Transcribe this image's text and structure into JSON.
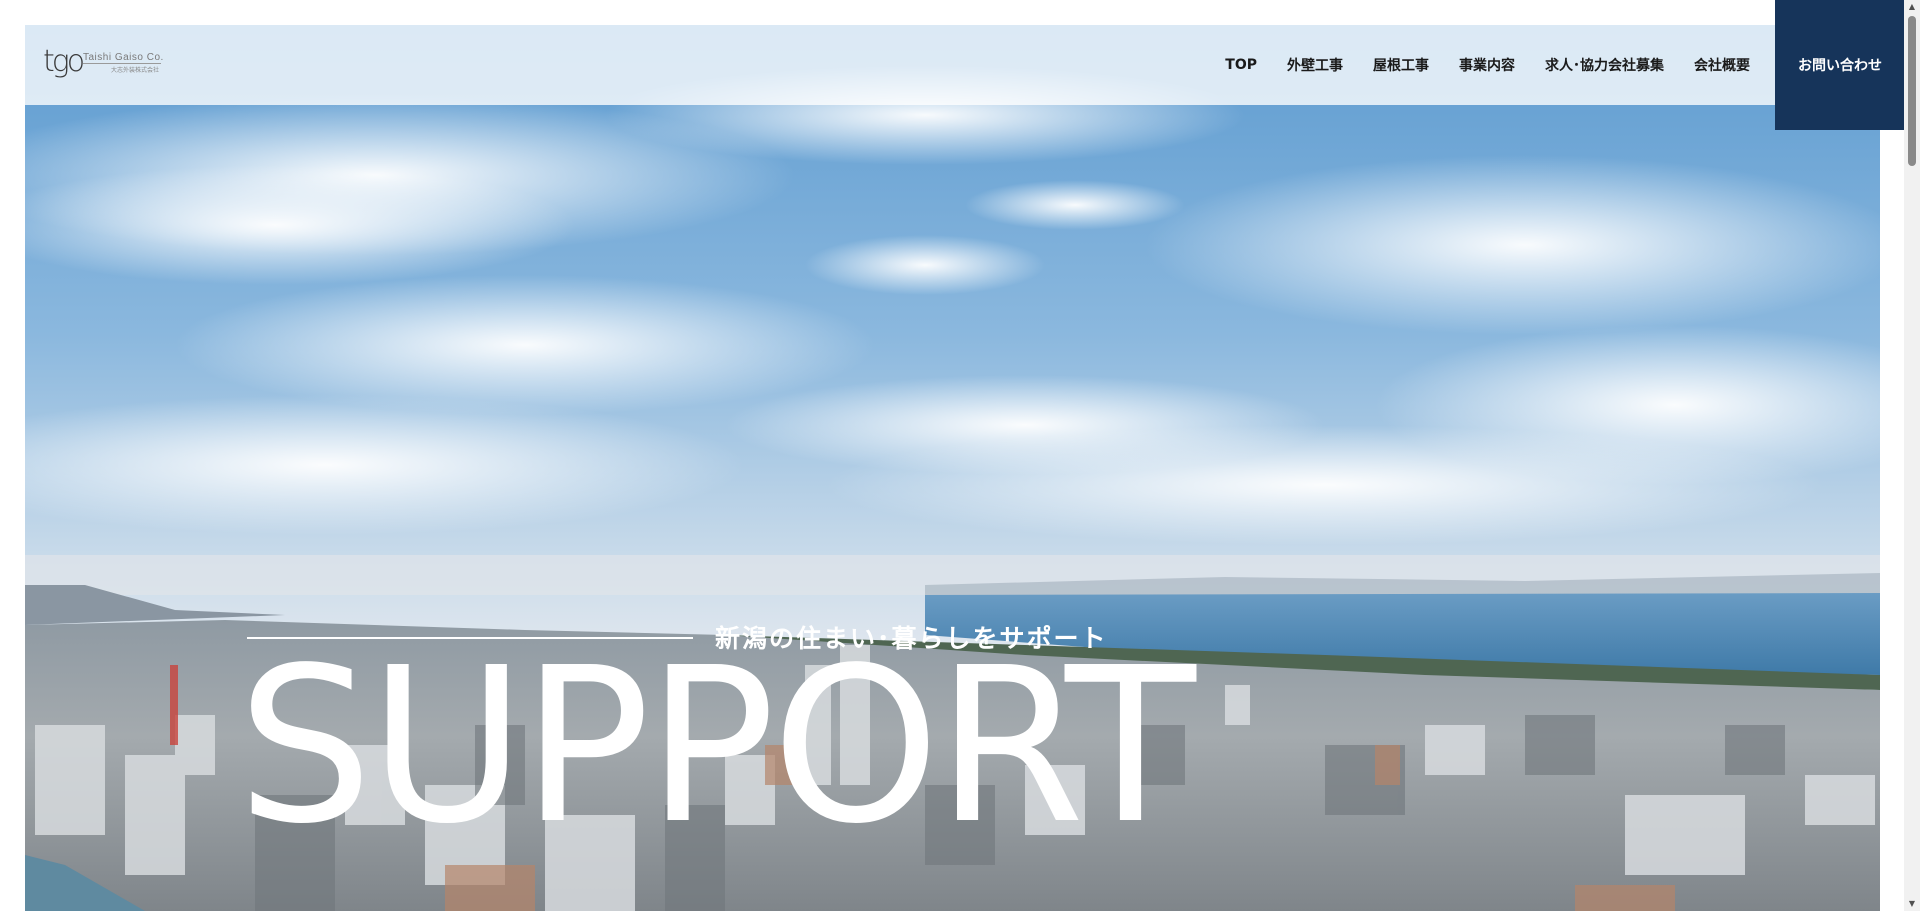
{
  "logo": {
    "mark": "tgo",
    "name": "Taishi Gaiso Co.",
    "sub": "大志外装株式会社"
  },
  "nav": {
    "items": [
      {
        "label": "TOP"
      },
      {
        "label": "外壁工事"
      },
      {
        "label": "屋根工事"
      },
      {
        "label": "事業内容"
      },
      {
        "label": "求人･協力会社募集"
      },
      {
        "label": "会社概要"
      }
    ],
    "contact_label": "お問い合わせ"
  },
  "hero": {
    "tagline": "新潟の住まい･暮らしをサポート",
    "headline": "SUPPORT"
  },
  "colors": {
    "accent": "#16345a",
    "header_bg": "rgba(255,255,255,0.78)",
    "text": "#1a1a1a"
  },
  "scrollbar": {
    "up_icon": "triangle-up-icon",
    "down_icon": "triangle-down-icon"
  }
}
